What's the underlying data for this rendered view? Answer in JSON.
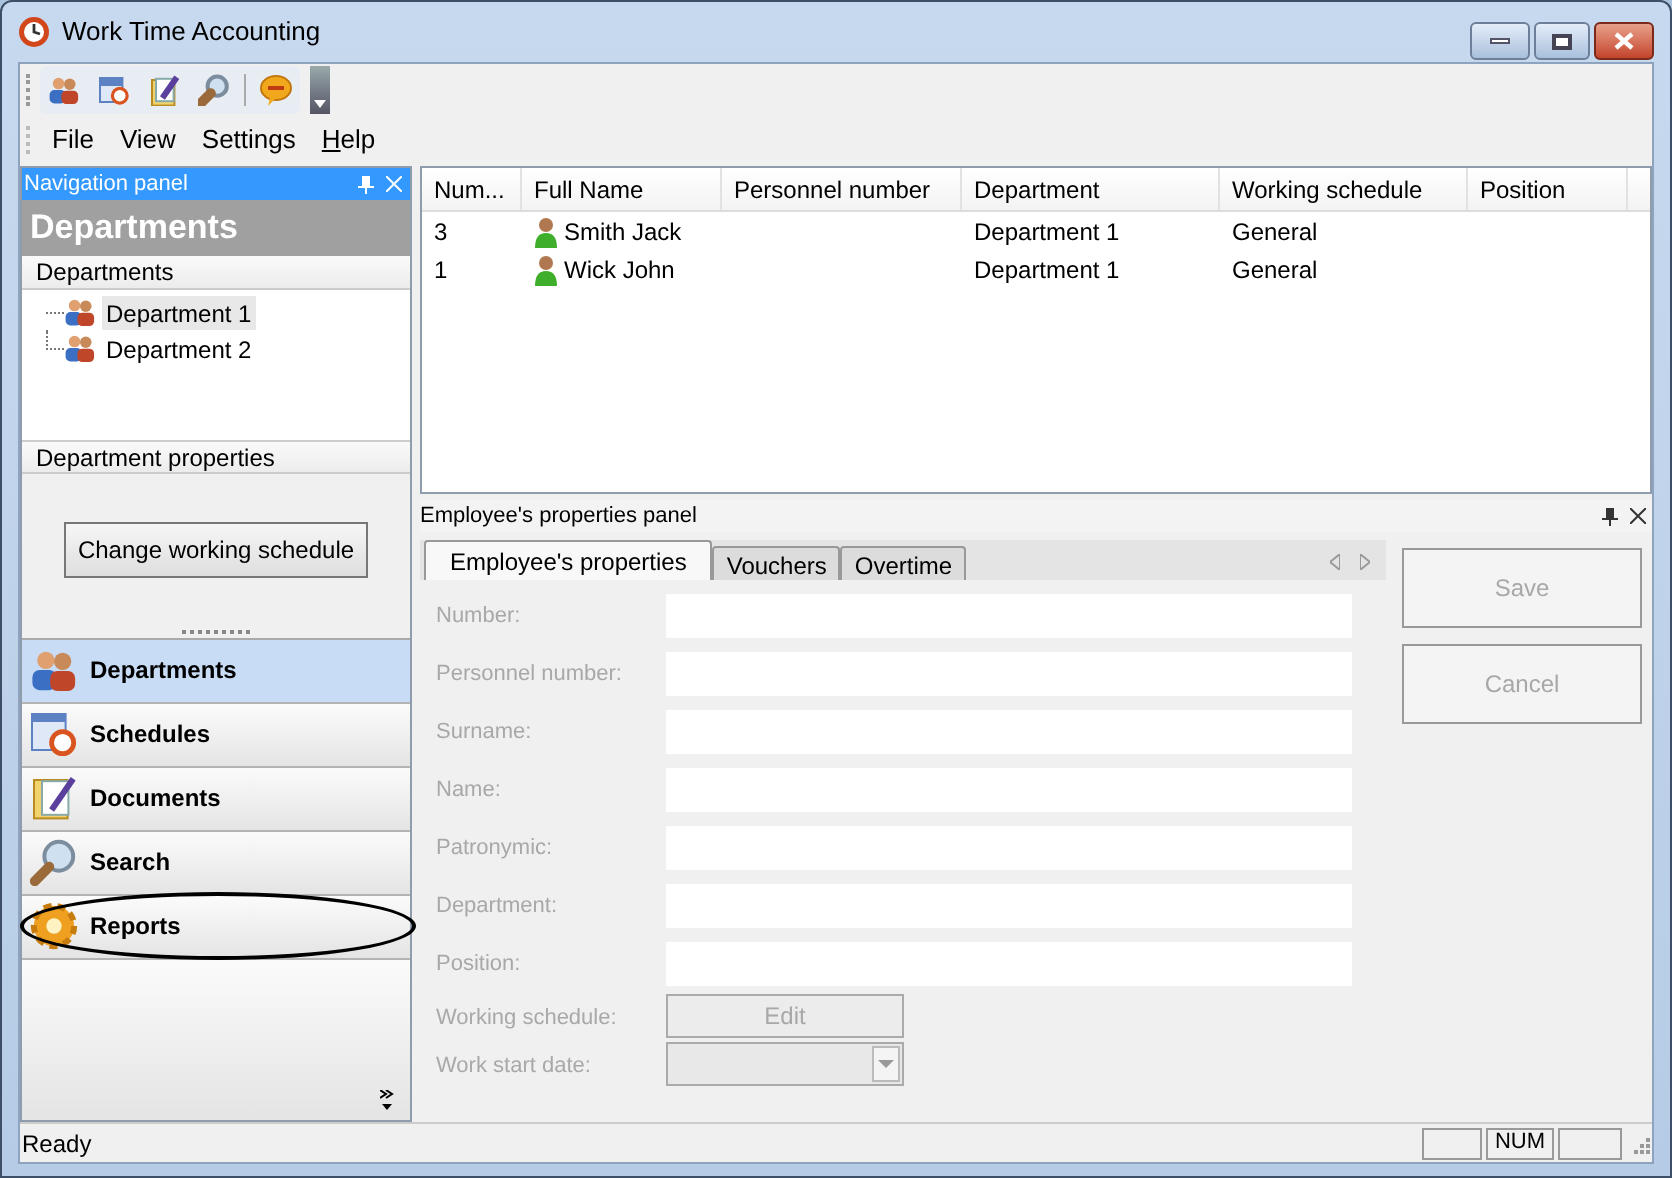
{
  "window": {
    "title": "Work Time Accounting"
  },
  "menu": [
    {
      "label": "File",
      "mnemonic": false
    },
    {
      "label": "View",
      "mnemonic": false
    },
    {
      "label": "Settings",
      "mnemonic": false
    },
    {
      "label": "Help",
      "mnemonic": true
    }
  ],
  "navigation_panel": {
    "title": "Navigation panel",
    "heading": "Departments",
    "section": "Departments",
    "tree": [
      {
        "label": "Department 1",
        "selected": true
      },
      {
        "label": "Department 2",
        "selected": false
      }
    ],
    "properties_section": "Department properties",
    "properties_button": "Change working schedule",
    "buttons": [
      {
        "label": "Departments",
        "kind": "people",
        "selected": true
      },
      {
        "label": "Schedules",
        "kind": "calendar",
        "selected": false
      },
      {
        "label": "Documents",
        "kind": "documents",
        "selected": false
      },
      {
        "label": "Search",
        "kind": "search",
        "selected": false
      },
      {
        "label": "Reports",
        "kind": "gear",
        "selected": false,
        "circled": true
      }
    ]
  },
  "table": {
    "columns": [
      "Num...",
      "Full Name",
      "Personnel number",
      "Department",
      "Working schedule",
      "Position"
    ],
    "rows": [
      [
        "3",
        "Smith Jack",
        "",
        "Department 1",
        "General",
        ""
      ],
      [
        "1",
        "Wick John",
        "",
        "Department 1",
        "General",
        ""
      ]
    ]
  },
  "properties_panel": {
    "title": "Employee's properties panel",
    "tabs": [
      {
        "label": "Employee's properties",
        "selected": true
      },
      {
        "label": "Vouchers",
        "selected": false
      },
      {
        "label": "Overtime",
        "selected": false
      }
    ],
    "fields": [
      {
        "label": "Number:",
        "kind": "text"
      },
      {
        "label": "Personnel number:",
        "kind": "text"
      },
      {
        "label": "Surname:",
        "kind": "text"
      },
      {
        "label": "Name:",
        "kind": "text"
      },
      {
        "label": "Patronymic:",
        "kind": "text"
      },
      {
        "label": "Department:",
        "kind": "text"
      },
      {
        "label": "Position:",
        "kind": "text"
      },
      {
        "label": "Working schedule:",
        "kind": "button",
        "button": "Edit"
      },
      {
        "label": "Work start date:",
        "kind": "dropdown"
      }
    ],
    "disabled": true,
    "buttons": [
      {
        "label": "Save",
        "disabled": true
      },
      {
        "label": "Cancel",
        "disabled": true
      }
    ]
  },
  "status_bar": {
    "text": "Ready",
    "indicator": "NUM"
  }
}
